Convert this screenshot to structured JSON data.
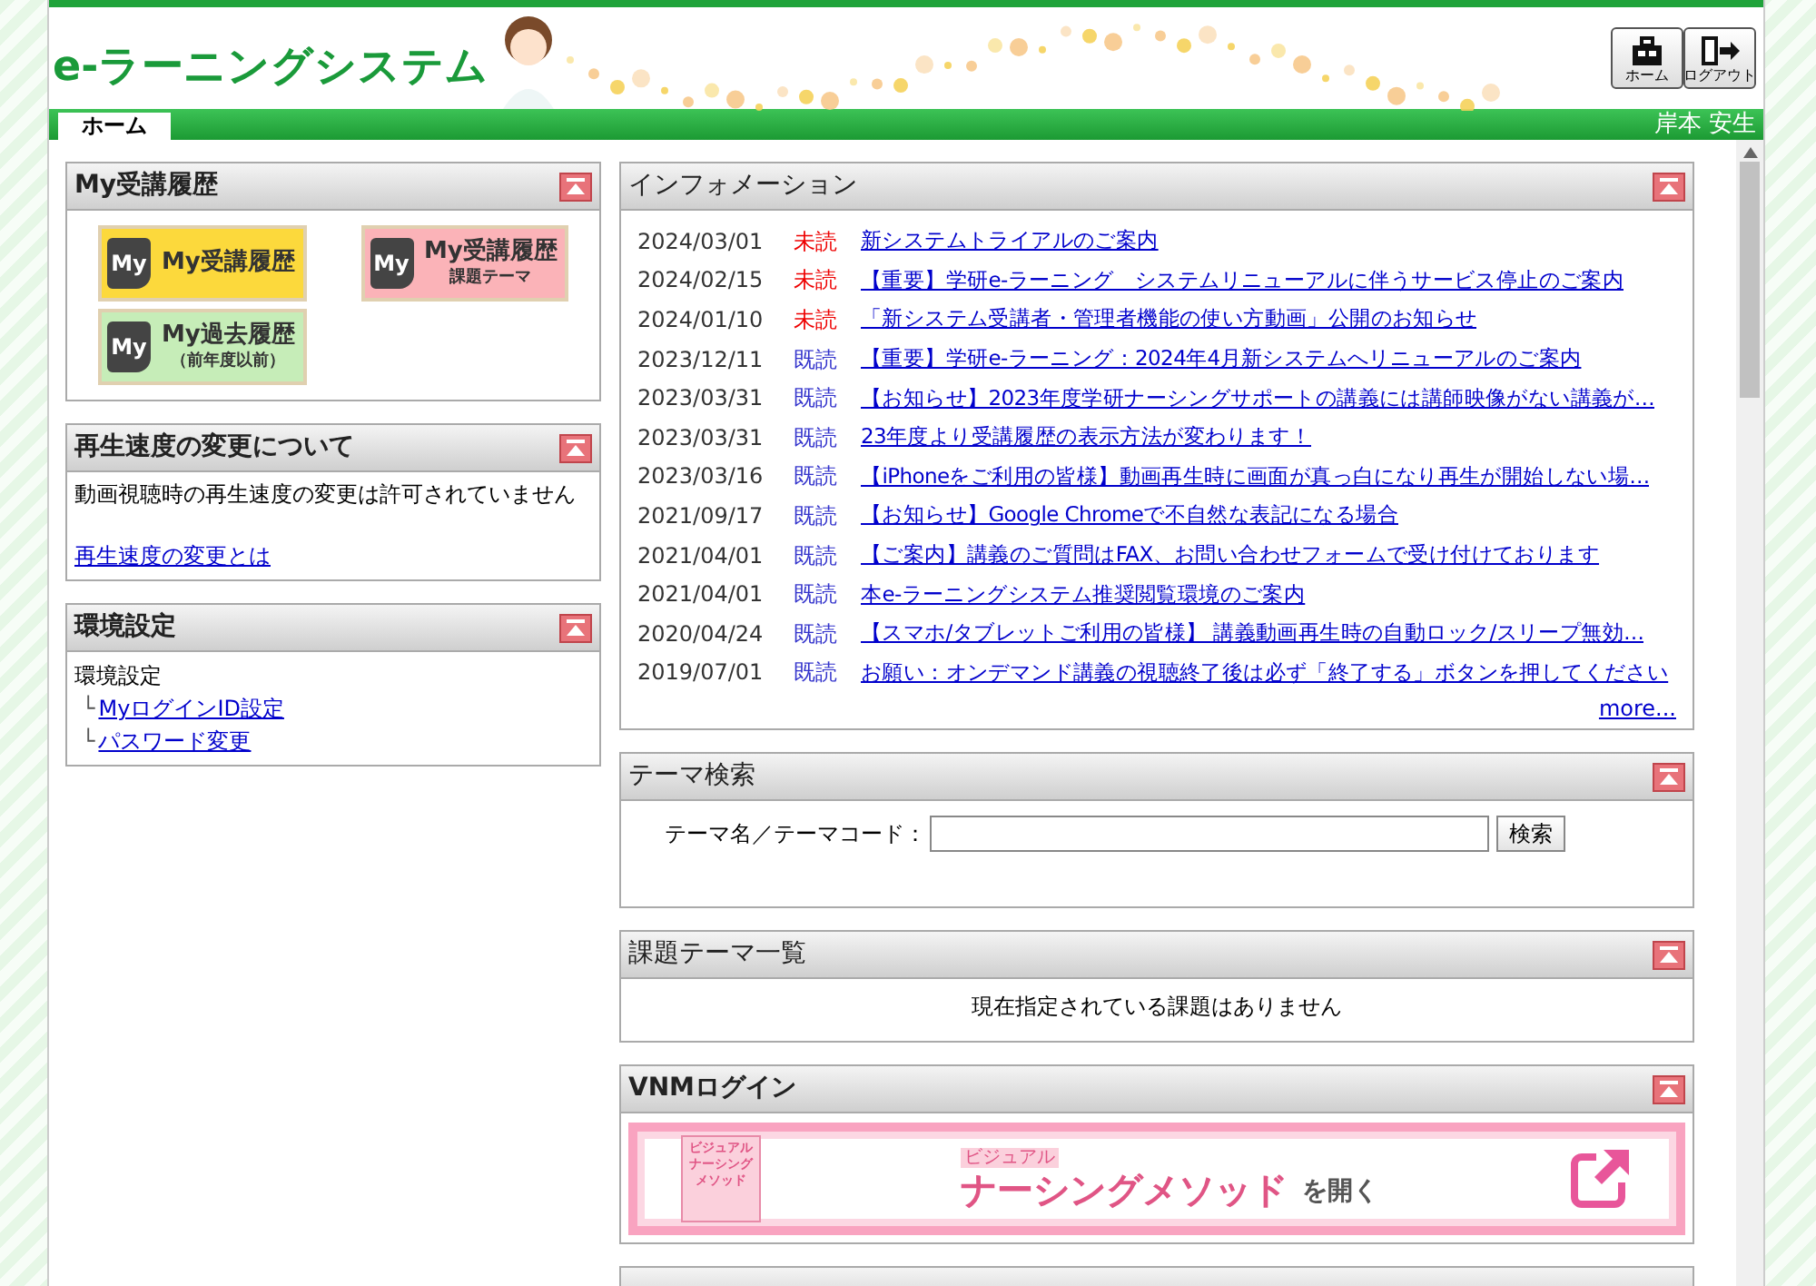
{
  "header": {
    "logo": "e-ラーニングシステム",
    "buttons": [
      {
        "label": "ホーム",
        "kind": "home"
      },
      {
        "label": "ログアウト",
        "kind": "logout"
      }
    ]
  },
  "nav": {
    "tabs": [
      {
        "label": "ホーム",
        "selected": true
      }
    ],
    "user": "岸本 安生"
  },
  "left": {
    "history": {
      "title": "My受講履歴",
      "buttons": [
        {
          "badge": "My",
          "label": "My受講履歴",
          "color": "#fcd93c"
        },
        {
          "badge": "My",
          "label": "My受講履歴",
          "sub": "課題テーマ",
          "color": "#fbb3b8"
        },
        {
          "badge": "My",
          "label": "My過去履歴",
          "sub": "（前年度以前）",
          "color": "#c6edb8"
        }
      ]
    },
    "speed": {
      "title": "再生速度の変更について",
      "text": "動画視聴時の再生速度の変更は許可されていません",
      "link": "再生速度の変更とは"
    },
    "settings": {
      "title": "環境設定",
      "text": "環境設定",
      "links": [
        {
          "prefix": "└",
          "label": "MyログインID設定"
        },
        {
          "prefix": "└",
          "label": "パスワード変更"
        }
      ]
    }
  },
  "info": {
    "title": "インフォメーション",
    "items": [
      {
        "date": "2024/03/01",
        "status": "未読",
        "read": false,
        "title": "新システムトライアルのご案内"
      },
      {
        "date": "2024/02/15",
        "status": "未読",
        "read": false,
        "title": "【重要】学研e-ラーニング　システムリニューアルに伴うサービス停止のご案内"
      },
      {
        "date": "2024/01/10",
        "status": "未読",
        "read": false,
        "title": "「新システム受講者・管理者機能の使い方動画」公開のお知らせ"
      },
      {
        "date": "2023/12/11",
        "status": "既読",
        "read": true,
        "title": "【重要】学研e-ラーニング：2024年4月新システムへリニューアルのご案内"
      },
      {
        "date": "2023/03/31",
        "status": "既読",
        "read": true,
        "title": "【お知らせ】2023年度学研ナーシングサポートの講義には講師映像がない講義が…"
      },
      {
        "date": "2023/03/31",
        "status": "既読",
        "read": true,
        "title": "23年度より受講履歴の表示方法が変わります！"
      },
      {
        "date": "2023/03/16",
        "status": "既読",
        "read": true,
        "title": "【iPhoneをご利用の皆様】動画再生時に画面が真っ白になり再生が開始しない場…"
      },
      {
        "date": "2021/09/17",
        "status": "既読",
        "read": true,
        "title": "【お知らせ】Google Chromeで不自然な表記になる場合"
      },
      {
        "date": "2021/04/01",
        "status": "既読",
        "read": true,
        "title": "【ご案内】講義のご質問はFAX、お問い合わせフォームで受け付けております"
      },
      {
        "date": "2021/04/01",
        "status": "既読",
        "read": true,
        "title": "本e-ラーニングシステム推奨閲覧環境のご案内"
      },
      {
        "date": "2020/04/24",
        "status": "既読",
        "read": true,
        "title": "【スマホ/タブレットご利用の皆様】 講義動画再生時の自動ロック/スリープ無効…"
      },
      {
        "date": "2019/07/01",
        "status": "既読",
        "read": true,
        "title": "お願い：オンデマンド講義の視聴終了後は必ず「終了する」ボタンを押してください"
      }
    ],
    "more": "more..."
  },
  "search": {
    "title": "テーマ検索",
    "label": "テーマ名／テーマコード：",
    "button": "検索"
  },
  "assignments": {
    "title": "課題テーマ一覧",
    "empty": "現在指定されている課題はありません"
  },
  "vnm": {
    "title": "VNMログイン",
    "book": "ビジュアルナーシングメソッド",
    "small": "ビジュアル",
    "brand": "ナーシングメソッド",
    "open": "を開く"
  }
}
